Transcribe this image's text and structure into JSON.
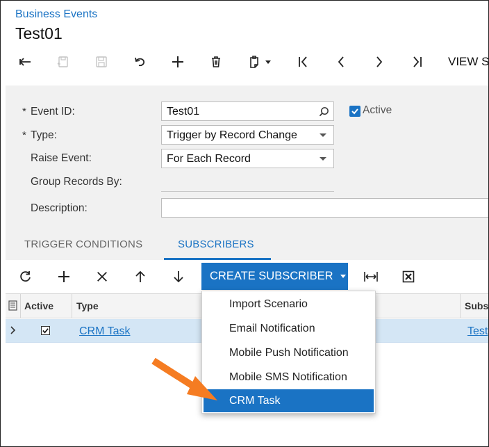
{
  "header": {
    "breadcrumb": "Business Events",
    "title": "Test01"
  },
  "toolbar": {
    "view_label": "VIEW S"
  },
  "form": {
    "event_id_label": "Event ID:",
    "event_id_value": "Test01",
    "active_label": "Active",
    "active_checked": true,
    "type_label": "Type:",
    "type_value": "Trigger by Record Change",
    "raise_event_label": "Raise Event:",
    "raise_event_value": "For Each Record",
    "group_records_label": "Group Records By:",
    "description_label": "Description:",
    "description_value": "",
    "required_marker": "*"
  },
  "tabs": [
    {
      "label": "TRIGGER CONDITIONS",
      "active": false
    },
    {
      "label": "SUBSCRIBERS",
      "active": true
    }
  ],
  "grid": {
    "create_subscriber_label": "CREATE SUBSCRIBER",
    "columns": {
      "active": "Active",
      "type": "Type",
      "subs": "Subs"
    },
    "rows": [
      {
        "active": true,
        "type": "CRM Task",
        "subscriber": "Test"
      }
    ]
  },
  "dropdown": {
    "items": [
      "Import Scenario",
      "Email Notification",
      "Mobile Push Notification",
      "Mobile SMS Notification",
      "CRM Task"
    ],
    "selected_index": 4
  },
  "colors": {
    "accent": "#1a73c4",
    "annotation_arrow": "#f57c22"
  }
}
